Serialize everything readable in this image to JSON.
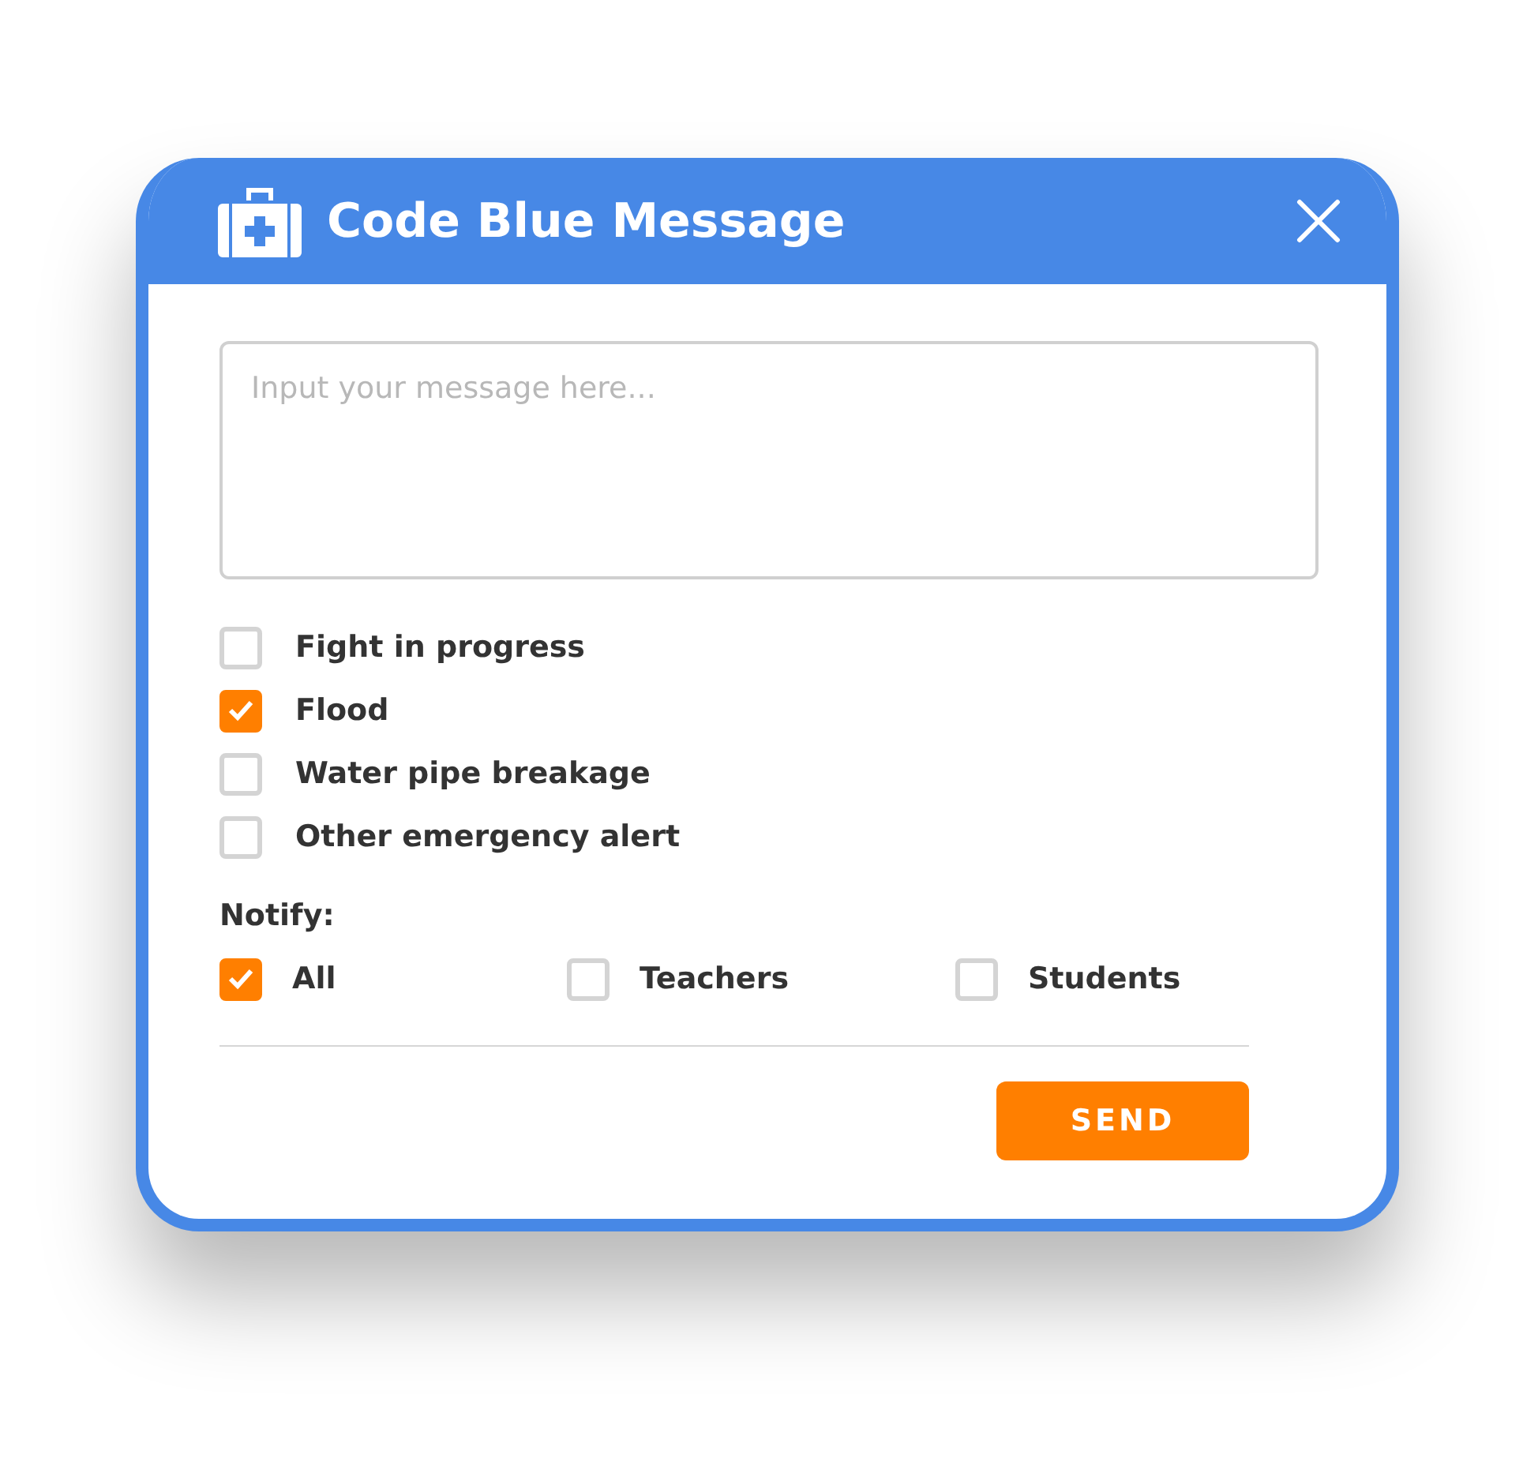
{
  "window": {
    "title": "Code Blue Message"
  },
  "message": {
    "placeholder": "Input your message here..."
  },
  "alerts": [
    {
      "label": "Fight in progress",
      "checked": false
    },
    {
      "label": "Flood",
      "checked": true
    },
    {
      "label": "Water pipe breakage",
      "checked": false
    },
    {
      "label": "Other emergency alert",
      "checked": false
    }
  ],
  "notify": {
    "label": "Notify:",
    "options": [
      {
        "label": "All",
        "checked": true
      },
      {
        "label": "Teachers",
        "checked": false
      },
      {
        "label": "Students",
        "checked": false
      }
    ]
  },
  "send_button": "SEND"
}
